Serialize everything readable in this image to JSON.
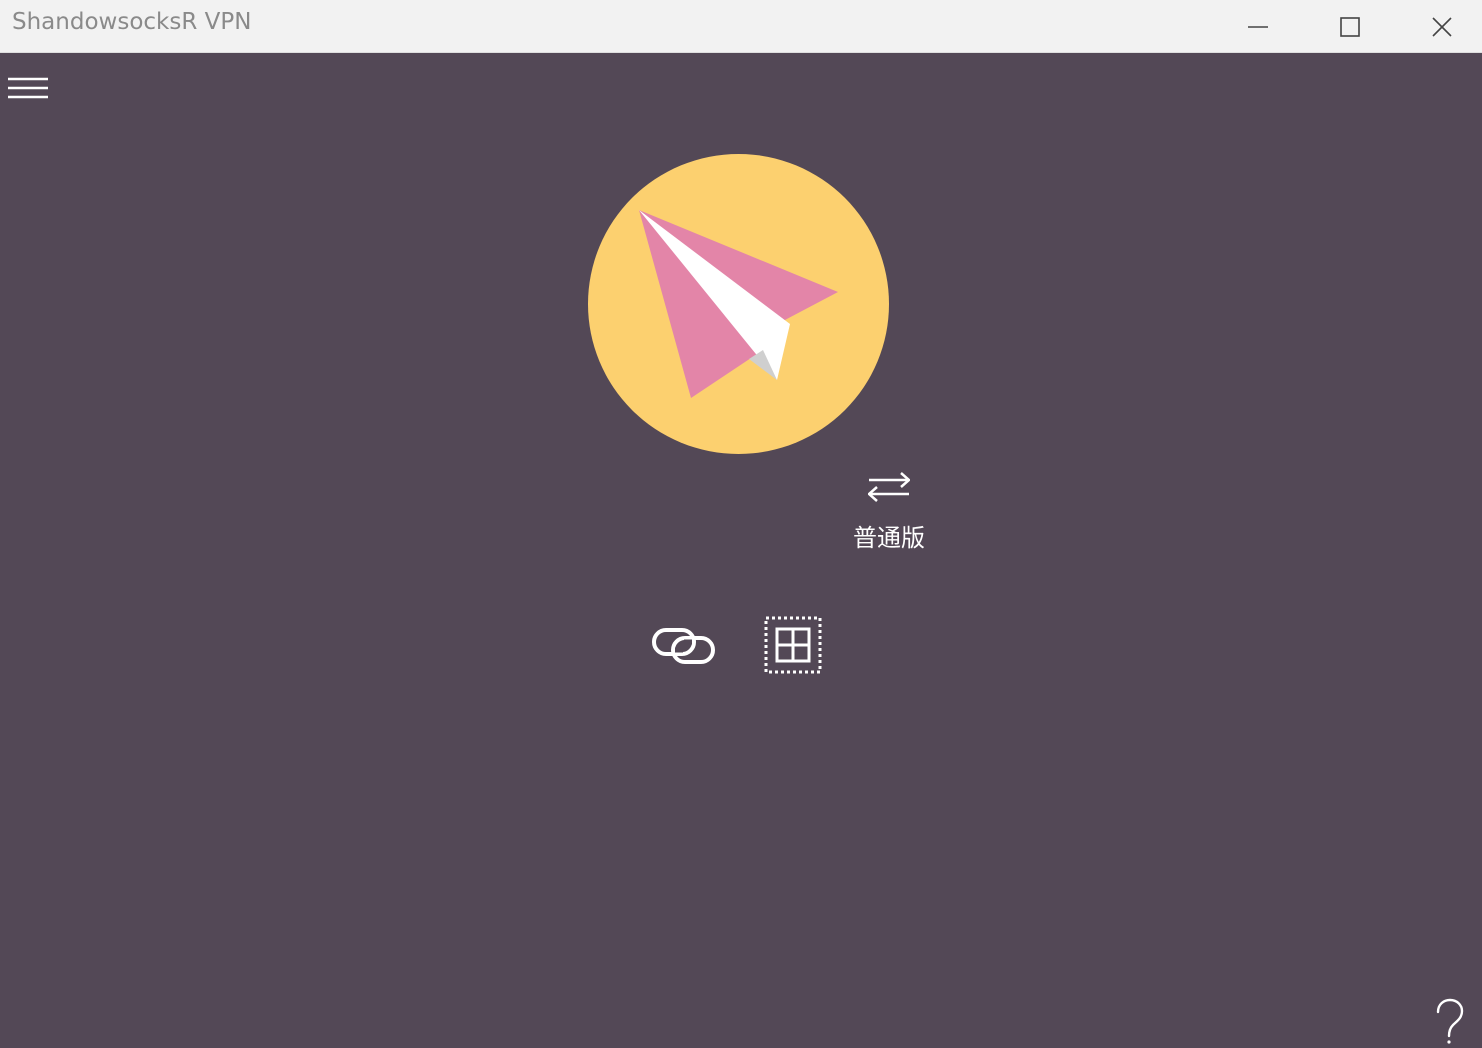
{
  "window": {
    "title": "ShandowsocksR VPN",
    "background": "#534856",
    "titlebar_background": "#f2f2f2",
    "title_color": "#8a8a8a"
  },
  "title_controls": {
    "minimize_icon": "minimize-icon",
    "maximize_icon": "maximize-icon",
    "close_icon": "close-icon"
  },
  "toolbar": {
    "menu_icon": "hamburger-menu-icon"
  },
  "main": {
    "power_button_icon": "paper-plane-icon",
    "power_button_color": "#fcd06f",
    "plane_color": "#e385a8",
    "mode": {
      "icon": "swap-arrows-icon",
      "label": "普通版"
    },
    "actions": [
      {
        "icon": "link-icon"
      },
      {
        "icon": "qr-scan-icon"
      }
    ]
  },
  "footer": {
    "help_icon": "question-mark-icon",
    "help_text": "?"
  }
}
